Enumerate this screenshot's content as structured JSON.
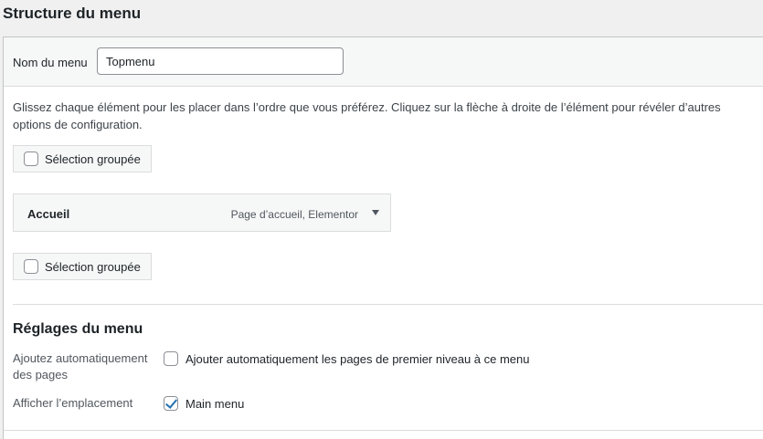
{
  "page": {
    "title": "Structure du menu"
  },
  "menu_name": {
    "label": "Nom du menu",
    "value": "Topmenu"
  },
  "instructions": "Glissez chaque élément pour les placer dans l’ordre que vous préférez. Cliquez sur la flèche à droite de l’élément pour révéler d’autres options de configuration.",
  "bulk_select": {
    "label": "Sélection groupée",
    "checked": false
  },
  "menu_items": [
    {
      "title": "Accueil",
      "type": "Page d’accueil, Elementor"
    }
  ],
  "settings": {
    "title": "Réglages du menu",
    "auto_add": {
      "label": "Ajoutez automatiquement des pages",
      "option": "Ajouter automatiquement les pages de premier niveau à ce menu",
      "checked": false
    },
    "location": {
      "label": "Afficher l’emplacement",
      "option": "Main menu",
      "checked": true
    }
  },
  "colors": {
    "accent": "#2271b1",
    "panel_bg": "#f6f7f7",
    "border": "#dcdcde"
  }
}
